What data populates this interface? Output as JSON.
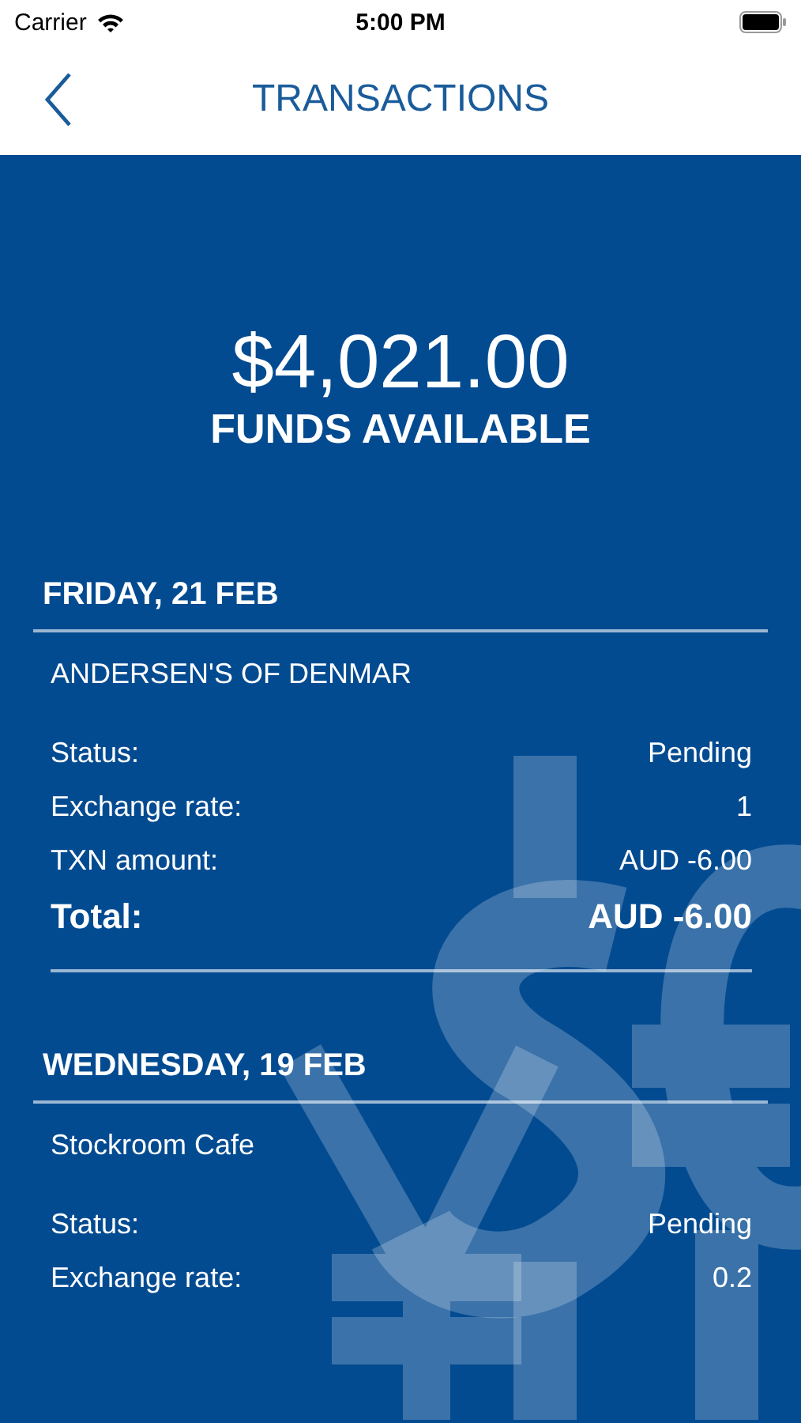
{
  "status_bar": {
    "carrier": "Carrier",
    "time": "5:00 PM"
  },
  "nav": {
    "title": "TRANSACTIONS"
  },
  "balance": {
    "amount": "$4,021.00",
    "label": "FUNDS AVAILABLE"
  },
  "days": [
    {
      "date": "FRIDAY, 21 FEB",
      "transactions": [
        {
          "merchant": "ANDERSEN'S OF DENMAR",
          "rows": [
            {
              "kind": "field",
              "label": "Status:",
              "value": "Pending"
            },
            {
              "kind": "field",
              "label": "Exchange rate:",
              "value": "1"
            },
            {
              "kind": "field",
              "label": "TXN amount:",
              "value": "AUD -6.00"
            },
            {
              "kind": "total",
              "label": "Total:",
              "value": "AUD -6.00"
            }
          ]
        }
      ]
    },
    {
      "date": "WEDNESDAY, 19 FEB",
      "transactions": [
        {
          "merchant": "Stockroom Cafe",
          "rows": [
            {
              "kind": "field",
              "label": "Status:",
              "value": "Pending"
            },
            {
              "kind": "field",
              "label": "Exchange rate:",
              "value": "0.2"
            }
          ]
        }
      ]
    }
  ]
}
